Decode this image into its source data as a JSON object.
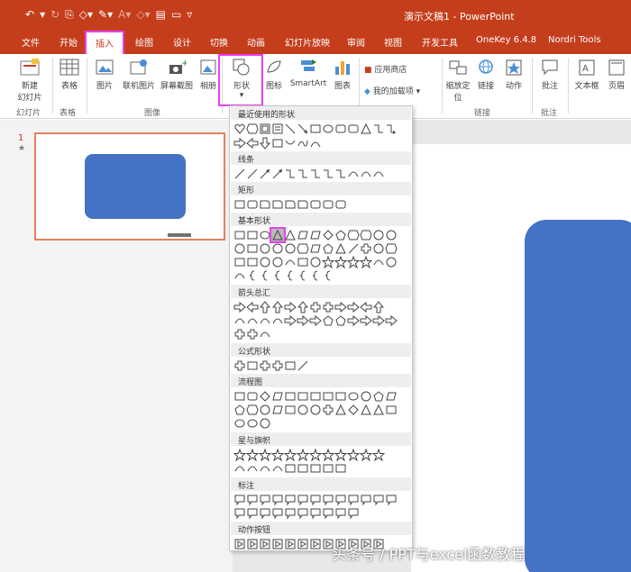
{
  "titlebar": {
    "title": "演示文稿1 - PowerPoint"
  },
  "qat": {
    "undo": "↶",
    "undo_arrow": "▾",
    "redo": "↻",
    "format_painter": "⎘",
    "fill": "◇▾",
    "pen": "✎▾",
    "fontcolor": "A▾",
    "shape_fill": "◇▾",
    "save": "▤",
    "open": "▭",
    "customize": "▿"
  },
  "tabs": [
    {
      "label": "文件"
    },
    {
      "label": "开始"
    },
    {
      "label": "插入"
    },
    {
      "label": "绘图"
    },
    {
      "label": "设计"
    },
    {
      "label": "切换"
    },
    {
      "label": "动画"
    },
    {
      "label": "幻灯片放映"
    },
    {
      "label": "审阅"
    },
    {
      "label": "视图"
    },
    {
      "label": "开发工具"
    },
    {
      "label": "OneKey 6.4.8"
    },
    {
      "label": "Nordri Tools"
    }
  ],
  "ribbon": {
    "new_slide": "新建\n幻灯片",
    "new_slide_1": "新建",
    "new_slide_2": "幻灯片",
    "table": "表格",
    "picture": "图片",
    "online_picture": "联机图片",
    "screenshot": "屏幕截图",
    "album": "相册",
    "shapes": "形状",
    "icons": "图标",
    "smartart": "SmartArt",
    "chart": "图表",
    "store": "应用商店",
    "my_addins": "我的加载项",
    "zoom": "缩放定",
    "zoom2": "位",
    "link": "链接",
    "action": "动作",
    "comment": "批注",
    "textbox": "文本框",
    "header": "页眉",
    "groups": {
      "slides": "幻灯片",
      "tables": "表格",
      "images": "图像",
      "links": "链接",
      "comments": "批注"
    }
  },
  "slides": [
    {
      "number": "1",
      "marker": "★"
    }
  ],
  "gallery": {
    "categories": [
      "最近使用的形状",
      "线条",
      "矩形",
      "基本形状",
      "箭头总汇",
      "公式形状",
      "流程图",
      "星与旗帜",
      "标注",
      "动作按钮"
    ]
  },
  "watermark": "头条号 / PPT与excel函数教程",
  "colors": {
    "accent": "#c43e1c",
    "shape_blue": "#4472c4",
    "highlight": "#e93ff0"
  }
}
